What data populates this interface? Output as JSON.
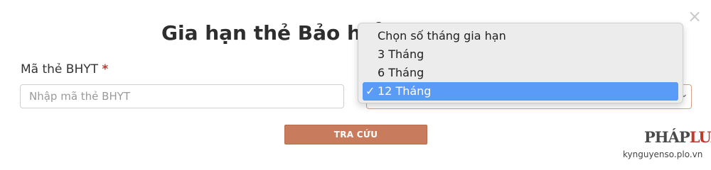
{
  "modal": {
    "title": "Gia hạn thẻ Bảo hiểm",
    "close_icon": "close-icon"
  },
  "form": {
    "card_label": "Mã thẻ BHYT",
    "required_mark": "*",
    "card_placeholder": "Nhập mã thẻ BHYT",
    "card_value": "",
    "months_select": {
      "selected": "12 Tháng",
      "options": [
        "Chọn số tháng gia hạn",
        "3 Tháng",
        "6 Tháng",
        "12 Tháng"
      ]
    },
    "submit_label": "TRA CỨU"
  },
  "watermark": {
    "logo_part1": "PHÁP",
    "logo_part2": "LUẬT",
    "site": "kynguyenso.plo.vn"
  },
  "colors": {
    "button": "#c97c5d",
    "selected_option": "#5a9bf8",
    "required": "#c0392b"
  }
}
